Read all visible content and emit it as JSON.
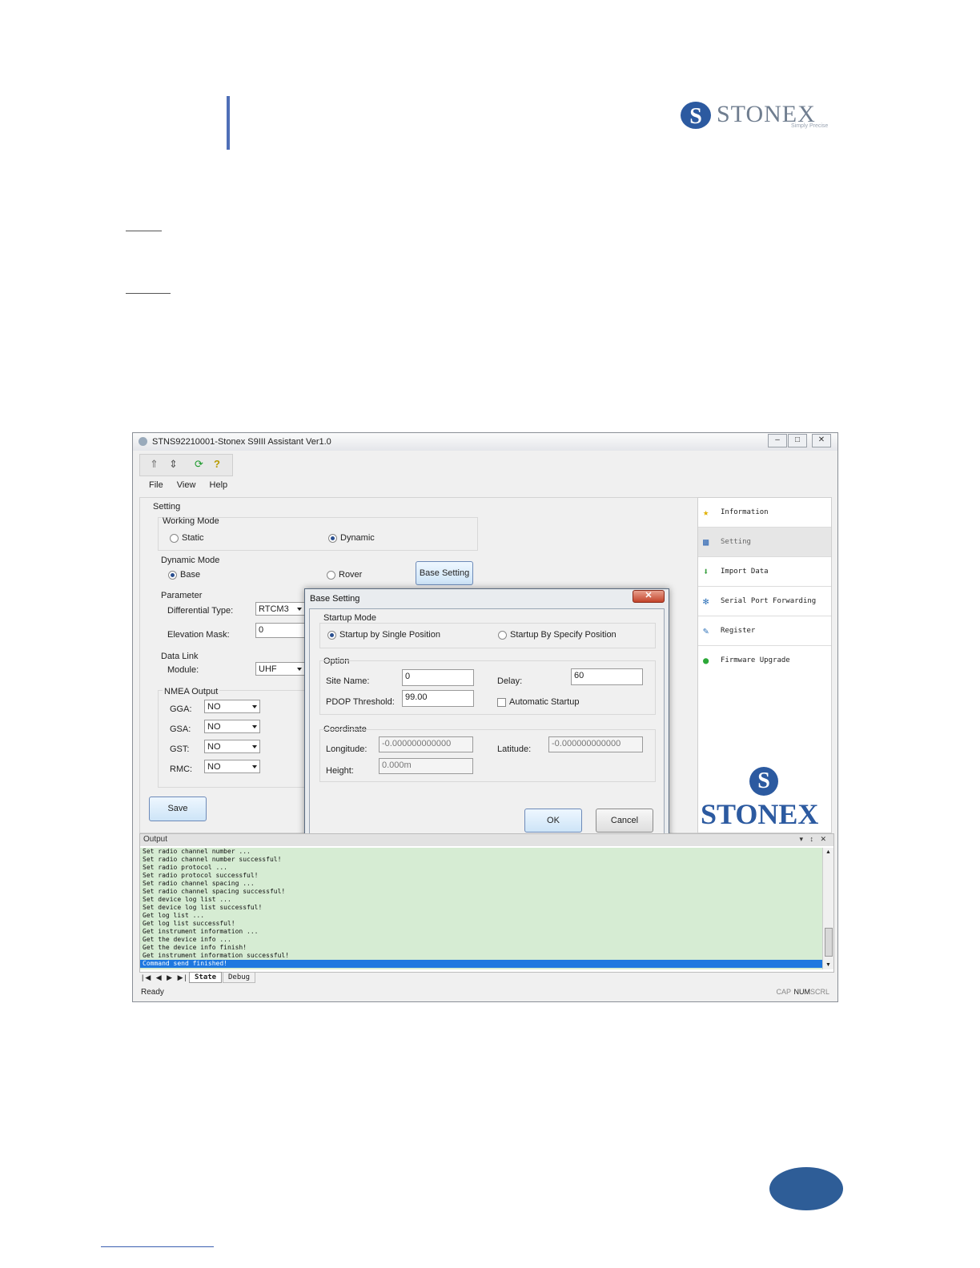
{
  "header": {
    "logo_text": "STONEX",
    "logo_tagline": "Simply Precise"
  },
  "window": {
    "title": "STNS92210001-Stonex S9III Assistant Ver1.0",
    "controls": {
      "minimize": "–",
      "maximize": "□",
      "close": "✕"
    },
    "toolbar_icons": [
      "connect-icon",
      "disconnect-icon",
      "refresh-icon",
      "help-icon"
    ],
    "menu": [
      "File",
      "View",
      "Help"
    ],
    "setting": {
      "title": "Setting",
      "working_mode": {
        "label": "Working Mode",
        "options": [
          "Static",
          "Dynamic"
        ],
        "selected": "Dynamic"
      },
      "dynamic_mode": {
        "label": "Dynamic Mode",
        "options": [
          "Base",
          "Rover"
        ],
        "selected": "Base",
        "base_setting_button": "Base Setting"
      },
      "parameter": {
        "label": "Parameter",
        "differential_type_label": "Differential Type:",
        "differential_type_value": "RTCM3",
        "elevation_mask_label": "Elevation Mask:",
        "elevation_mask_value": "0"
      },
      "data_link": {
        "label": "Data Link",
        "module_label": "Module:",
        "module_value": "UHF"
      },
      "nmea_output": {
        "label": "NMEA Output",
        "rows": [
          {
            "label": "GGA:",
            "value": "NO"
          },
          {
            "label": "GSA:",
            "value": "NO"
          },
          {
            "label": "GST:",
            "value": "NO"
          },
          {
            "label": "RMC:",
            "value": "NO"
          }
        ]
      },
      "save_button": "Save"
    },
    "sidebar": {
      "items": [
        {
          "label": "Information",
          "icon": "star-icon"
        },
        {
          "label": "Setting",
          "icon": "settings-icon"
        },
        {
          "label": "Import Data",
          "icon": "download-icon"
        },
        {
          "label": "Serial Port Forwarding",
          "icon": "network-icon"
        },
        {
          "label": "Register",
          "icon": "register-icon"
        },
        {
          "label": "Firmware Upgrade",
          "icon": "upgrade-icon"
        }
      ],
      "selected": "Setting",
      "brand_mark": "S",
      "brand_text": "STONEX"
    },
    "dialog": {
      "title": "Base Setting",
      "close": "✕",
      "startup_mode": {
        "label": "Startup Mode",
        "options": [
          "Startup by Single Position",
          "Startup By Specify Position"
        ],
        "selected": "Startup by Single Position"
      },
      "option": {
        "label": "Option",
        "site_name_label": "Site Name:",
        "site_name_value": "0",
        "delay_label": "Delay:",
        "delay_value": "60",
        "pdop_label": "PDOP Threshold:",
        "pdop_value": "99.00",
        "auto_startup_label": "Automatic Startup"
      },
      "coordinate": {
        "label": "Coordinate",
        "longitude_label": "Longitude:",
        "longitude_value": "-0.000000000000",
        "latitude_label": "Latitude:",
        "latitude_value": "-0.000000000000",
        "height_label": "Height:",
        "height_value": "0.000m"
      },
      "ok_button": "OK",
      "cancel_button": "Cancel"
    },
    "output": {
      "title": "Output",
      "controls": "▾ ↕ ✕",
      "lines": [
        "Set radio channel number ...",
        "Set radio channel number successful!",
        "Set radio protocol ...",
        "Set radio protocol successful!",
        "Set radio channel spacing ...",
        "Set radio channel spacing successful!",
        "Set device log list ...",
        "Set device log list successful!",
        "Get log list ...",
        "Get log list successful!",
        "Get instrument information ...",
        "Get the device info ...",
        "Get the device info finish!",
        "Get instrument information successful!",
        "Command send finished!"
      ],
      "tabs": [
        "State",
        "Debug"
      ],
      "nav": "|◀ ◀ ▶ ▶|"
    },
    "status": {
      "text": "Ready",
      "indicators": [
        "CAP",
        "NUM",
        "SCRL"
      ]
    }
  }
}
